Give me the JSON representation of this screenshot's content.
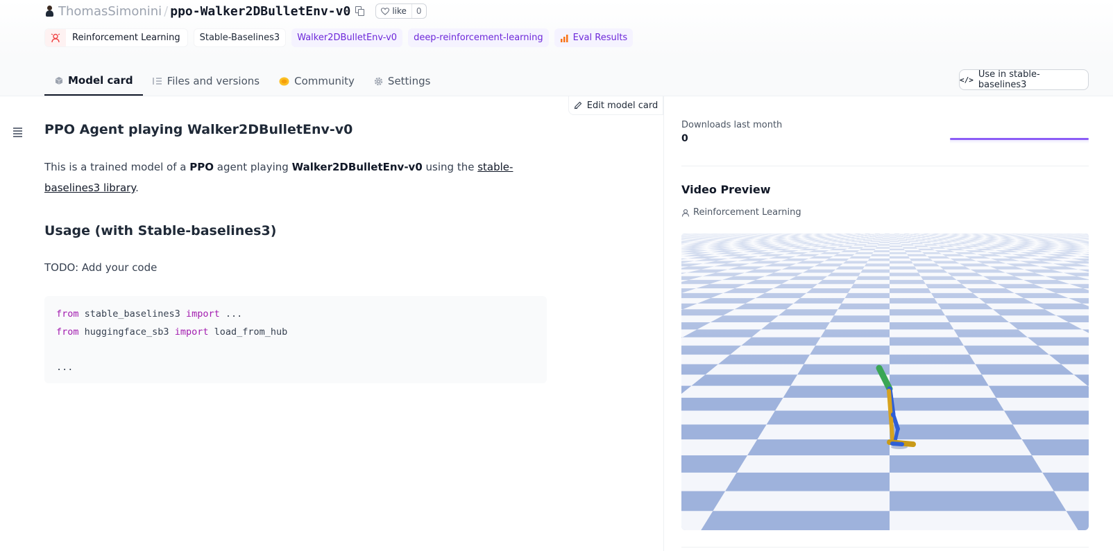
{
  "repo": {
    "owner": "ThomasSimonini",
    "separator": "/",
    "name": "ppo-Walker2DBulletEnv-v0",
    "like_label": "like",
    "like_count": "0"
  },
  "tags": {
    "task": "Reinforcement Learning",
    "library": "Stable-Baselines3",
    "env": "Walker2DBulletEnv-v0",
    "course": "deep-reinforcement-learning",
    "eval": "Eval Results"
  },
  "tabs": {
    "model_card": "Model card",
    "files": "Files and versions",
    "community": "Community",
    "settings": "Settings"
  },
  "use_button": "Use in stable-baselines3",
  "edit_button": "Edit model card",
  "content": {
    "title": "PPO Agent playing Walker2DBulletEnv-v0",
    "para_1": "This is a trained model of a ",
    "para_bold_1": "PPO",
    "para_2": " agent playing ",
    "para_bold_2": "Walker2DBulletEnv-v0",
    "para_3": " using the ",
    "para_link": "stable-baselines3 library",
    "para_end": ".",
    "usage_heading": "Usage (with Stable-baselines3)",
    "todo": "TODO: Add your code",
    "code": {
      "l1_kw1": "from",
      "l1_mid": " stable_baselines3 ",
      "l1_kw2": "import",
      "l1_end": " ...",
      "l2_kw1": "from",
      "l2_mid": " huggingface_sb3 ",
      "l2_kw2": "import",
      "l2_end": " load_from_hub",
      "l4": "..."
    }
  },
  "sidebar": {
    "downloads_label": "Downloads last month",
    "downloads_count": "0",
    "video_title": "Video Preview",
    "video_task": "Reinforcement Learning"
  },
  "colors": {
    "accent_purple": "#6d28d9",
    "graph_line": "#8b5cf6",
    "checker_blue": "#9eb2dc",
    "checker_white": "#f4f6fb"
  }
}
